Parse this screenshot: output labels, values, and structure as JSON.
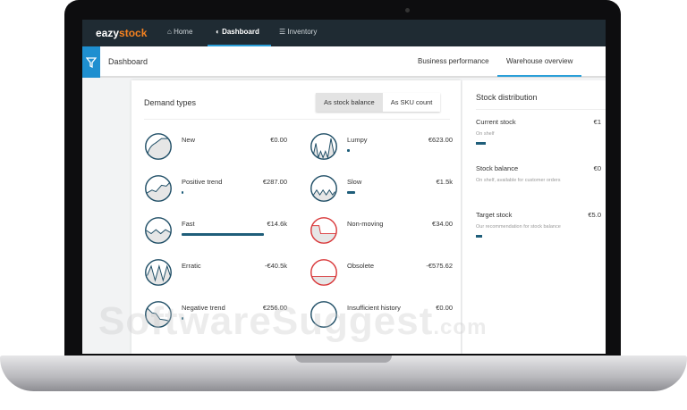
{
  "nav": {
    "logo_a": "eazy",
    "logo_b": "stock",
    "items": [
      {
        "label": "Home"
      },
      {
        "label": "Dashboard"
      },
      {
        "label": "Inventory"
      }
    ]
  },
  "subheader": {
    "title": "Dashboard",
    "tabs": [
      {
        "label": "Business performance"
      },
      {
        "label": "Warehouse overview"
      }
    ]
  },
  "demand": {
    "title": "Demand types",
    "toggle": [
      "As stock balance",
      "As SKU count"
    ],
    "items": [
      {
        "label": "New",
        "value": "€0.00",
        "bar_fraction": 0,
        "icon": "new",
        "color": "#1f4e66"
      },
      {
        "label": "Positive trend",
        "value": "€287.00",
        "bar_fraction": 0.02,
        "icon": "positive",
        "color": "#1f4e66"
      },
      {
        "label": "Fast",
        "value": "€14.6k",
        "bar_fraction": 1,
        "icon": "fast",
        "color": "#1f4e66"
      },
      {
        "label": "Erratic",
        "value": "-€40.5k",
        "bar_fraction": 0,
        "icon": "erratic",
        "color": "#1f4e66"
      },
      {
        "label": "Negative trend",
        "value": "€256.00",
        "bar_fraction": 0.02,
        "icon": "negative",
        "color": "#1f4e66"
      },
      {
        "label": "Lumpy",
        "value": "€623.00",
        "bar_fraction": 0.03,
        "icon": "lumpy",
        "color": "#1f4e66"
      },
      {
        "label": "Slow",
        "value": "€1.5k",
        "bar_fraction": 0.1,
        "icon": "slow",
        "color": "#1f4e66"
      },
      {
        "label": "Non-moving",
        "value": "€34.00",
        "bar_fraction": 0,
        "icon": "nonmoving",
        "color": "#d9383a"
      },
      {
        "label": "Obsolete",
        "value": "-€575.62",
        "bar_fraction": 0,
        "icon": "obsolete",
        "color": "#d9383a"
      },
      {
        "label": "Insufficient history",
        "value": "€0.00",
        "bar_fraction": 0,
        "icon": "insufficient",
        "color": "#1f4e66"
      }
    ]
  },
  "distribution": {
    "title": "Stock distribution",
    "items": [
      {
        "label": "Current stock",
        "sub": "On shelf",
        "value": "€1",
        "bar_fraction": 0.08
      },
      {
        "label": "Stock balance",
        "sub": "On shelf, available for customer orders",
        "value": "€0",
        "bar_fraction": 0
      },
      {
        "label": "Target stock",
        "sub": "Our recommendation for stock balance",
        "value": "€5.0",
        "bar_fraction": 0.05
      }
    ]
  },
  "watermark": {
    "text": "SoftwareSuggest",
    "suffix": ".com"
  }
}
